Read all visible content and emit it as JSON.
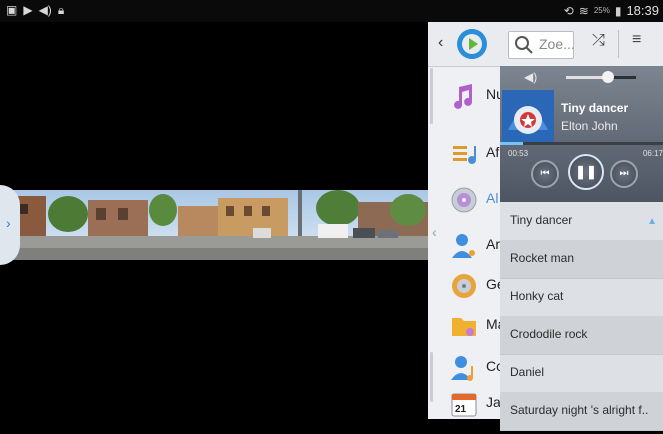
{
  "status_bar": {
    "left_icons": [
      "picture-icon",
      "play-icon",
      "speaker-icon",
      "lock-icon"
    ],
    "battery_percent": "25%",
    "time": "18:39"
  },
  "toolbar": {
    "search_placeholder": "Zoe...",
    "logo_color": "#2a8fd8"
  },
  "library_nav": {
    "items": [
      {
        "label": "Nu",
        "icon": "music-note-icon"
      },
      {
        "label": "Af",
        "icon": "playlist-icon"
      },
      {
        "label": "Al",
        "icon": "album-disc-icon"
      },
      {
        "label": "Ar",
        "icon": "artist-icon"
      },
      {
        "label": "Ge",
        "icon": "genre-icon"
      },
      {
        "label": "Ma",
        "icon": "folder-icon"
      },
      {
        "label": "Co",
        "icon": "composer-icon"
      },
      {
        "label": "Ja",
        "icon": "calendar-icon"
      }
    ],
    "calendar_day": "21"
  },
  "player": {
    "title": "Tiny dancer",
    "artist": "Elton John",
    "current_time": "00:53",
    "total_time": "06:17",
    "volume_level": 0.6,
    "progress_fraction": 0.14
  },
  "playlist": {
    "items": [
      "Tiny dancer",
      "Rocket man",
      "Honky cat",
      "Crododile rock",
      "Daniel",
      "Saturday night 's alright f.."
    ]
  }
}
